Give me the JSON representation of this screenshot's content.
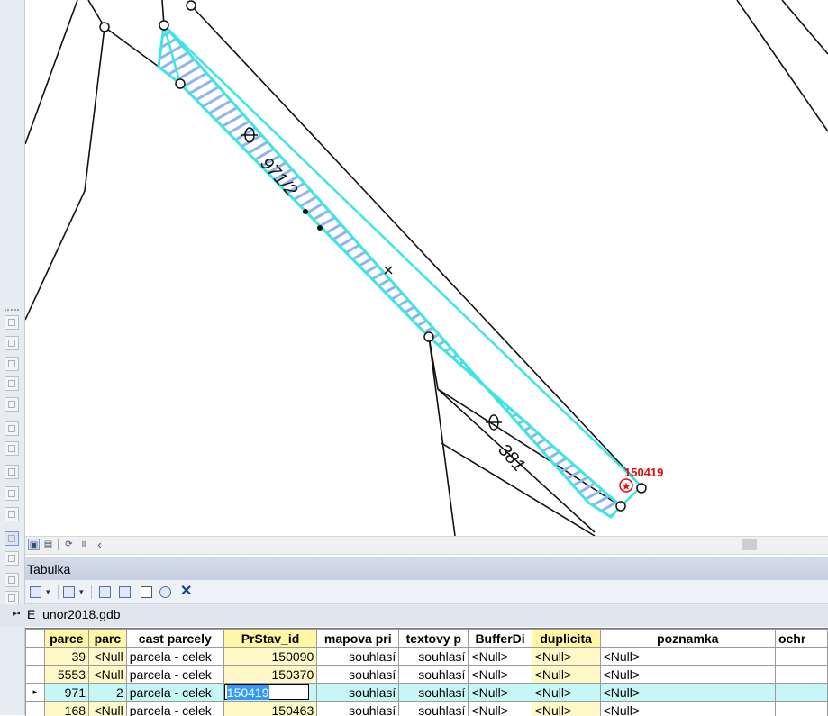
{
  "map": {
    "parcel_labels": [
      "971/2",
      "381"
    ],
    "point_label": "150419",
    "colors": {
      "selection_outline": "#3de5e5",
      "selection_hatch": "#8fb4ee",
      "lines": "#111111",
      "point_marker": "#dd1111"
    }
  },
  "left_toolbar": {
    "icons": [
      "add-data-icon",
      "layer-icon",
      "pan-hand-icon",
      "zoom-full-icon",
      "fixed-zoom-icon",
      "zoom-in-icon",
      "zoom-out-icon",
      "back-extent-icon",
      "forward-extent-icon",
      "select-features-icon",
      "data-view-icon",
      "layout-view-icon",
      "table-options-icon",
      "related-tables-icon"
    ]
  },
  "map_strip": {
    "buttons": [
      "data-view-icon",
      "layout-view-icon",
      "refresh-icon",
      "pause-icon",
      "scroll-left-icon"
    ],
    "glyphs": [
      "▣",
      "▤",
      "⟳",
      "॥",
      "‹"
    ]
  },
  "table_window": {
    "title": "Tabulka",
    "toolbar_icons": [
      "table-options-icon",
      "dropdown-arrow-icon",
      "related-tables-icon",
      "dropdown-arrow-icon",
      "select-by-attributes-icon",
      "switch-selection-icon",
      "clear-selection-icon",
      "zoom-to-selected-icon",
      "delete-selected-icon"
    ],
    "layer_tab": "E_unor2018.gdb",
    "columns": [
      "parce",
      "parc",
      "cast parcely",
      "PrStav_id",
      "mapova pri",
      "textovy p",
      "BufferDi",
      "duplicita",
      "poznamka",
      "ochr"
    ],
    "rows": [
      {
        "marker": "",
        "cells": [
          "39",
          "<Null",
          "parcela - celek",
          "150090",
          "souhlasí",
          "souhlasí",
          "<Null>",
          "<Null>",
          "<Null>",
          ""
        ]
      },
      {
        "marker": "",
        "cells": [
          "5553",
          "<Null",
          "parcela - celek",
          "150370",
          "souhlasí",
          "souhlasí",
          "<Null>",
          "<Null>",
          "<Null>",
          ""
        ]
      },
      {
        "marker": "▸",
        "cells": [
          "971",
          "2",
          "parcela - celek",
          "150419",
          "souhlasí",
          "souhlasí",
          "<Null>",
          "<Null>",
          "<Null>",
          ""
        ]
      },
      {
        "marker": "",
        "cells": [
          "168",
          "<Null",
          "parcela - celek",
          "150463",
          "souhlasí",
          "souhlasí",
          "<Null>",
          "<Null>",
          "<Null>",
          ""
        ]
      }
    ]
  }
}
